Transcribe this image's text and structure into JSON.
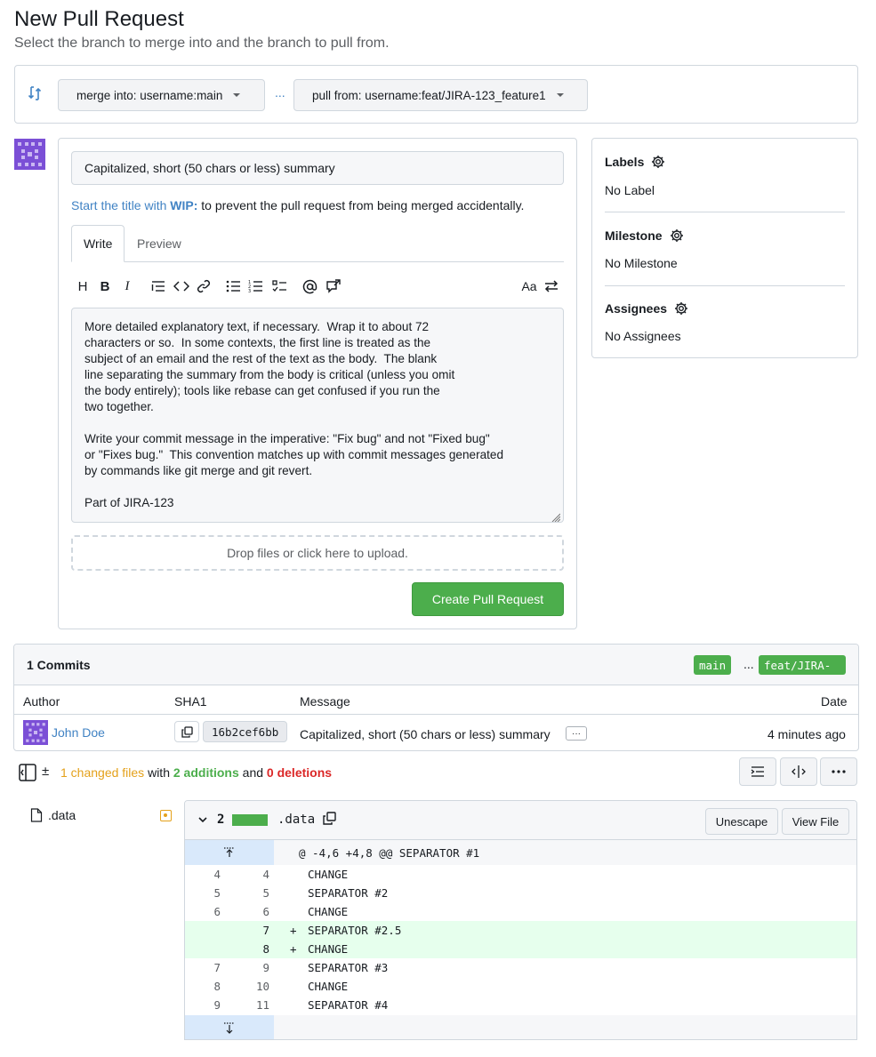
{
  "header": {
    "title": "New Pull Request",
    "subtitle": "Select the branch to merge into and the branch to pull from."
  },
  "compare": {
    "merge_into": "merge into: username:main",
    "ellipsis": "...",
    "pull_from": "pull from: username:feat/JIRA-123_feature1"
  },
  "form": {
    "title_value": "Capitalized, short (50 chars or less) summary",
    "wip_prefix": "Start the title with",
    "wip_keyword": "WIP:",
    "wip_suffix": "to prevent the pull request from being merged accidentally.",
    "tabs": {
      "write": "Write",
      "preview": "Preview"
    },
    "toolbar": {
      "heading": "H",
      "bold": "B",
      "italic": "I",
      "font_size": "Aa"
    },
    "body": "More detailed explanatory text, if necessary.  Wrap it to about 72\ncharacters or so.  In some contexts, the first line is treated as the\nsubject of an email and the rest of the text as the body.  The blank\nline separating the summary from the body is critical (unless you omit\nthe body entirely); tools like rebase can get confused if you run the\ntwo together.\n\nWrite your commit message in the imperative: \"Fix bug\" and not \"Fixed bug\"\nor \"Fixes bug.\"  This convention matches up with commit messages generated\nby commands like git merge and git revert.\n\nPart of JIRA-123",
    "dropzone": "Drop files or click here to upload.",
    "submit": "Create Pull Request"
  },
  "sidebar": {
    "labels_title": "Labels",
    "labels_value": "No Label",
    "milestone_title": "Milestone",
    "milestone_value": "No Milestone",
    "assignees_title": "Assignees",
    "assignees_value": "No Assignees"
  },
  "commits": {
    "count": "1 Commits",
    "base_branch": "main",
    "dots": "...",
    "head_branch": "feat/JIRA-",
    "columns": {
      "author": "Author",
      "sha": "SHA1",
      "message": "Message",
      "date": "Date"
    },
    "rows": [
      {
        "author": "John Doe",
        "sha": "16b2cef6bb",
        "message": "Capitalized, short (50 chars or less) summary",
        "more": "···",
        "date": "4 minutes ago"
      }
    ]
  },
  "diff_stats": {
    "plus_minus": "±",
    "changed": "1 changed files",
    "with": "with",
    "additions": "2 additions",
    "and": "and",
    "deletions": "0 deletions"
  },
  "file_tree": {
    "file": ".data"
  },
  "diff": {
    "count": "2",
    "filename": ".data",
    "unescape": "Unescape",
    "view_file": "View File",
    "hunk": "@ -4,6 +4,8 @@ SEPARATOR #1",
    "lines": [
      {
        "old": "4",
        "new": "4",
        "sign": "",
        "code": "CHANGE",
        "type": "ctx"
      },
      {
        "old": "5",
        "new": "5",
        "sign": "",
        "code": "SEPARATOR #2",
        "type": "ctx"
      },
      {
        "old": "6",
        "new": "6",
        "sign": "",
        "code": "CHANGE",
        "type": "ctx"
      },
      {
        "old": "",
        "new": "7",
        "sign": "+",
        "code": "SEPARATOR #2.5",
        "type": "add"
      },
      {
        "old": "",
        "new": "8",
        "sign": "+",
        "code": "CHANGE",
        "type": "add"
      },
      {
        "old": "7",
        "new": "9",
        "sign": "",
        "code": "SEPARATOR #3",
        "type": "ctx"
      },
      {
        "old": "8",
        "new": "10",
        "sign": "",
        "code": "CHANGE",
        "type": "ctx"
      },
      {
        "old": "9",
        "new": "11",
        "sign": "",
        "code": "SEPARATOR #4",
        "type": "ctx"
      }
    ]
  },
  "colors": {
    "accent_blue": "#4183c4",
    "green": "#4cae4c",
    "orange": "#e4a11b",
    "red": "#db2828",
    "avatar": "#7b4fd6",
    "add_bg": "#e6ffed"
  }
}
